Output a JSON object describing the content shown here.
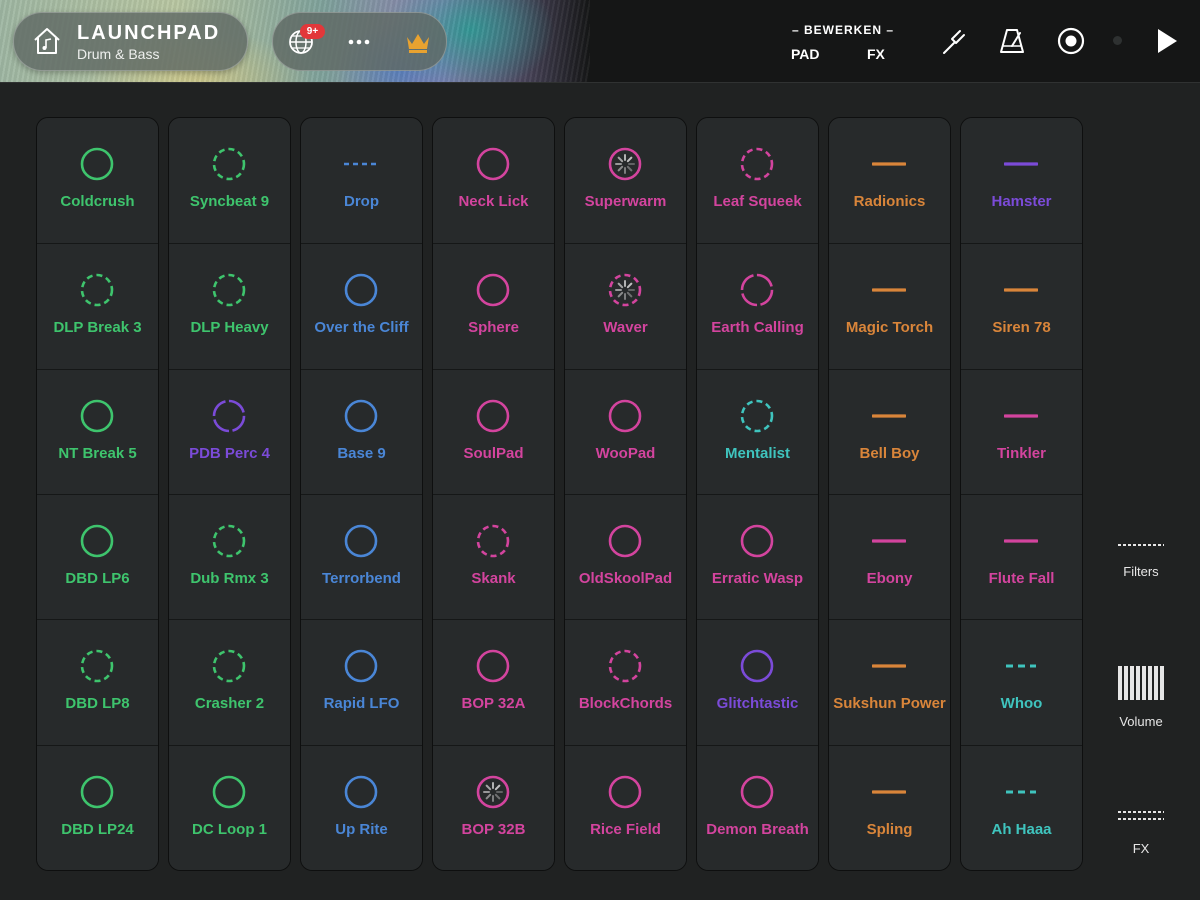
{
  "header": {
    "title": "LAUNCHPAD",
    "subtitle": "Drum & Bass",
    "notification_badge": "9+",
    "mode_title": "– BEWERKEN –",
    "mode_pad": "PAD",
    "mode_fx": "FX"
  },
  "colors": {
    "green": "#3ec46d",
    "blue": "#4a86d6",
    "pink": "#d3449e",
    "purple": "#7b4bd8",
    "teal": "#3fc4be",
    "orange": "#d9853a",
    "crown": "#e8a230"
  },
  "grid": {
    "columns": [
      [
        {
          "label": "Coldcrush",
          "color": "green",
          "icon": "ring-icon"
        },
        {
          "label": "DLP Break 3",
          "color": "green",
          "icon": "dashed-ring-icon"
        },
        {
          "label": "NT Break 5",
          "color": "green",
          "icon": "ring-icon"
        },
        {
          "label": "DBD LP6",
          "color": "green",
          "icon": "ring-icon"
        },
        {
          "label": "DBD LP8",
          "color": "green",
          "icon": "dashed-ring-icon"
        },
        {
          "label": "DBD LP24",
          "color": "green",
          "icon": "ring-icon"
        }
      ],
      [
        {
          "label": "Syncbeat 9",
          "color": "green",
          "icon": "dashed-ring-icon"
        },
        {
          "label": "DLP Heavy",
          "color": "green",
          "icon": "dashed-ring-icon"
        },
        {
          "label": "PDB Perc 4",
          "color": "purple",
          "icon": "segmented-ring-icon"
        },
        {
          "label": "Dub Rmx 3",
          "color": "green",
          "icon": "dashed-ring-icon"
        },
        {
          "label": "Crasher 2",
          "color": "green",
          "icon": "dashed-ring-icon"
        },
        {
          "label": "DC Loop 1",
          "color": "green",
          "icon": "ring-icon"
        }
      ],
      [
        {
          "label": "Drop",
          "color": "blue",
          "icon": "dotted-line-icon"
        },
        {
          "label": "Over the Cliff",
          "color": "blue",
          "icon": "ring-icon"
        },
        {
          "label": "Base 9",
          "color": "blue",
          "icon": "ring-icon"
        },
        {
          "label": "Terrorbend",
          "color": "blue",
          "icon": "ring-icon"
        },
        {
          "label": "Rapid LFO",
          "color": "blue",
          "icon": "ring-icon"
        },
        {
          "label": "Up Rite",
          "color": "blue",
          "icon": "ring-icon"
        }
      ],
      [
        {
          "label": "Neck Lick",
          "color": "pink",
          "icon": "ring-icon"
        },
        {
          "label": "Sphere",
          "color": "pink",
          "icon": "ring-icon"
        },
        {
          "label": "SoulPad",
          "color": "pink",
          "icon": "ring-icon"
        },
        {
          "label": "Skank",
          "color": "pink",
          "icon": "dashed-ring-icon"
        },
        {
          "label": "BOP 32A",
          "color": "pink",
          "icon": "ring-icon"
        },
        {
          "label": "BOP 32B",
          "color": "pink",
          "icon": "loading-ring-icon"
        }
      ],
      [
        {
          "label": "Superwarm",
          "color": "pink",
          "icon": "loading-ring-icon"
        },
        {
          "label": "Waver",
          "color": "pink",
          "icon": "loading-dashed-ring-icon"
        },
        {
          "label": "WooPad",
          "color": "pink",
          "icon": "ring-icon"
        },
        {
          "label": "OldSkoolPad",
          "color": "pink",
          "icon": "ring-icon"
        },
        {
          "label": "BlockChords",
          "color": "pink",
          "icon": "dashed-ring-icon"
        },
        {
          "label": "Rice Field",
          "color": "pink",
          "icon": "ring-icon"
        }
      ],
      [
        {
          "label": "Leaf Squeek",
          "color": "pink",
          "icon": "dashed-ring-icon"
        },
        {
          "label": "Earth Calling",
          "color": "pink",
          "icon": "segmented-ring-icon"
        },
        {
          "label": "Mentalist",
          "color": "teal",
          "icon": "dashed-ring-icon"
        },
        {
          "label": "Erratic Wasp",
          "color": "pink",
          "icon": "ring-icon"
        },
        {
          "label": "Glitchtastic",
          "color": "purple",
          "icon": "ring-icon"
        },
        {
          "label": "Demon Breath",
          "color": "pink",
          "icon": "ring-icon"
        }
      ],
      [
        {
          "label": "Radionics",
          "color": "orange",
          "icon": "line-icon"
        },
        {
          "label": "Magic Torch",
          "color": "orange",
          "icon": "line-icon"
        },
        {
          "label": "Bell Boy",
          "color": "orange",
          "icon": "line-icon"
        },
        {
          "label": "Ebony",
          "color": "pink",
          "icon": "line-icon"
        },
        {
          "label": "Sukshun Power",
          "color": "orange",
          "icon": "line-icon"
        },
        {
          "label": "Spling",
          "color": "orange",
          "icon": "line-icon"
        }
      ],
      [
        {
          "label": "Hamster",
          "color": "purple",
          "icon": "line-icon"
        },
        {
          "label": "Siren 78",
          "color": "orange",
          "icon": "line-icon"
        },
        {
          "label": "Tinkler",
          "color": "pink",
          "icon": "line-icon"
        },
        {
          "label": "Flute Fall",
          "color": "pink",
          "icon": "line-icon"
        },
        {
          "label": "Whoo",
          "color": "teal",
          "icon": "dashed-line-icon"
        },
        {
          "label": "Ah Haaa",
          "color": "teal",
          "icon": "dashed-line-icon"
        }
      ]
    ]
  },
  "side_controls": {
    "filters_label": "Filters",
    "volume_label": "Volume",
    "fx_label": "FX"
  }
}
